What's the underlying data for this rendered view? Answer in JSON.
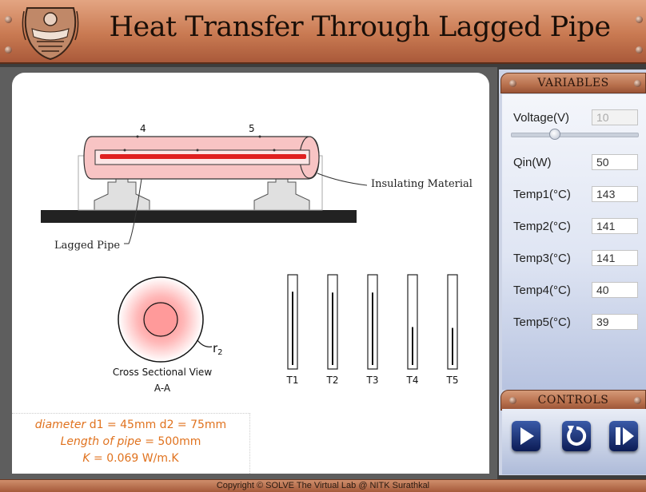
{
  "header": {
    "title": "Heat Transfer Through Lagged Pipe",
    "logo_icon": "nitk-emblem"
  },
  "diagram": {
    "thermocouple_labels": [
      "4",
      "5"
    ],
    "insulating_label": "Insulating Material",
    "lagged_pipe_label": "Lagged Pipe",
    "cross_section_label": "Cross Sectional View",
    "cross_section_sub": "A-A",
    "radius_label": "r",
    "radius_sub": "2",
    "thermometers": [
      {
        "label": "T1",
        "level": 0.85
      },
      {
        "label": "T2",
        "level": 0.84
      },
      {
        "label": "T3",
        "level": 0.84
      },
      {
        "label": "T4",
        "level": 0.44
      },
      {
        "label": "T5",
        "level": 0.43
      }
    ]
  },
  "info": {
    "line1_prefix": "diameter",
    "line1_value": " d1 = 45mm d2 = 75mm",
    "line2_prefix": "Length of pipe",
    "line2_value": " = 500mm",
    "line3_prefix": "K",
    "line3_value": " = 0.069 W/m.K"
  },
  "variables": {
    "heading": "VARIABLES",
    "voltage_label": "Voltage(V)",
    "voltage_value": "10",
    "voltage_slider": 0.35,
    "qin_label": "Qin(W)",
    "qin_value": "50",
    "temp1_label": "Temp1(°C)",
    "temp1_value": "143",
    "temp2_label": "Temp2(°C)",
    "temp2_value": "141",
    "temp3_label": "Temp3(°C)",
    "temp3_value": "141",
    "temp4_label": "Temp4(°C)",
    "temp4_value": "40",
    "temp5_label": "Temp5(°C)",
    "temp5_value": "39"
  },
  "controls": {
    "heading": "CONTROLS",
    "buttons": [
      "play-icon",
      "reset-icon",
      "step-icon"
    ]
  },
  "footer": {
    "copyright": "Copyright © SOLVE The Virtual Lab @ NITK Surathkal"
  },
  "colors": {
    "accent": "#c97a52",
    "info_text": "#e0721e",
    "button": "#1a2f78",
    "heater": "#e02020"
  }
}
